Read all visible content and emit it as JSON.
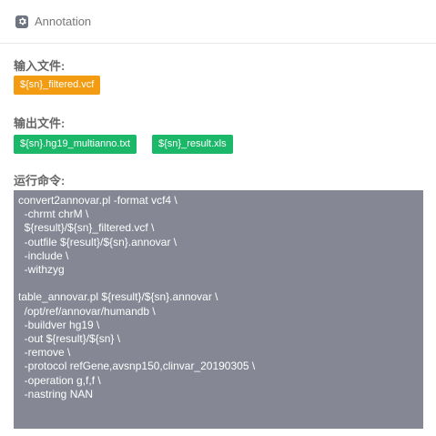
{
  "header": {
    "icon": "gear-icon",
    "title": "Annotation"
  },
  "input": {
    "label": "输入文件:",
    "files": [
      "${sn}_filtered.vcf"
    ]
  },
  "output": {
    "label": "输出文件:",
    "files": [
      "${sn}.hg19_multianno.txt",
      "${sn}_result.xls"
    ]
  },
  "command": {
    "label": "运行命令:",
    "text": "convert2annovar.pl -format vcf4 \\\n  -chrmt chrM \\\n  ${result}/${sn}_filtered.vcf \\\n  -outfile ${result}/${sn}.annovar \\\n  -include \\\n  -withzyg\n\ntable_annovar.pl ${result}/${sn}.annovar \\\n  /opt/ref/annovar/humandb \\\n  -buildver hg19 \\\n  -out ${result}/${sn} \\\n  -remove \\\n  -protocol refGene,avsnp150,clinvar_20190305 \\\n  -operation g,f,f \\\n  -nastring NAN"
  },
  "colors": {
    "input_tag": "#f39c12",
    "output_tag": "#1cb86a",
    "code_background": "#858894"
  }
}
